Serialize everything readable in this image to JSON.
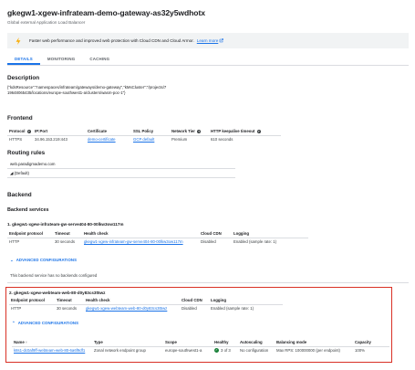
{
  "header": {
    "title": "gkegw1-xgew-infrateam-demo-gateway-as32y5wdhotx",
    "subtitle": "Global external Application Load Balancer"
  },
  "banner": {
    "text": "Faster web performance and improved web protection with Cloud CDN and Cloud Armor.",
    "link": "Learn more"
  },
  "tabs": [
    "DETAILS",
    "MONITORING",
    "CACHING"
  ],
  "description": {
    "heading": "Description",
    "text": "{\"kdsResource\":\"namespaces/infrateam/gateways/demo-gateway\",\"kMsCluster\":\"/projects/719648065435/locations/europe-southwest1-a/clusters/wasm-poc-1\"}"
  },
  "frontend": {
    "heading": "Frontend",
    "columns": [
      "Protocol",
      "IP:Port",
      "Certificate",
      "SSL Policy",
      "Network Tier",
      "HTTP keepalive timeout"
    ],
    "row": [
      "HTTPS",
      "34.96.153.219:443",
      "demo-certificate",
      "GCP default",
      "Premium",
      "610 seconds"
    ]
  },
  "routing": {
    "heading": "Routing rules",
    "rows": [
      "web.paradigmademo.com",
      "(Default)"
    ]
  },
  "backend": {
    "heading": "Backend",
    "services_heading": "Backend services",
    "service1": {
      "title": "1. gkegw1-xgew-infrateam-gw-serve404-80-00lkw3ow117m",
      "columns": [
        "Endpoint protocol",
        "Timeout",
        "Health check",
        "Cloud CDN",
        "Logging"
      ],
      "row": [
        "HTTP",
        "30 seconds",
        "gkegw1-xgew-infrateam-gw-serve404-80-00lkw3ow117m",
        "Disabled",
        "Enabled (sample rate: 1)"
      ],
      "advanced": "ADVANCED CONFIGURATIONS",
      "note": "This backend service has no backends configured"
    },
    "service2": {
      "title": "2. gkegw1-xgew-webteam-web-80-d0y83cs3t5wz",
      "columns": [
        "Endpoint protocol",
        "Timeout",
        "Health check",
        "Cloud CDN",
        "Logging"
      ],
      "row": [
        "HTTP",
        "30 seconds",
        "gkegw1-xgew-webteam-web-80-d0y83cs3t5wz",
        "Disabled",
        "Enabled (sample rate: 1)"
      ],
      "advanced": "ADVANCED CONFIGURATIONS",
      "backends": {
        "columns": [
          "Name",
          "Type",
          "Scope",
          "Healthy",
          "Autoscaling",
          "Balancing mode",
          "Capacity"
        ],
        "row": [
          "k8s1-dc0af9ff-webteam-web-80-6a6f9df1",
          "Zonal network endpoint group",
          "europe-southwest1-a",
          "3 of 3",
          "No configuration",
          "Max RPS: 100000000 (per endpoint)",
          "100%"
        ]
      }
    }
  },
  "colors": {
    "accent": "#1a73e8",
    "highlight_border": "#d93025",
    "healthy": "#188038"
  }
}
